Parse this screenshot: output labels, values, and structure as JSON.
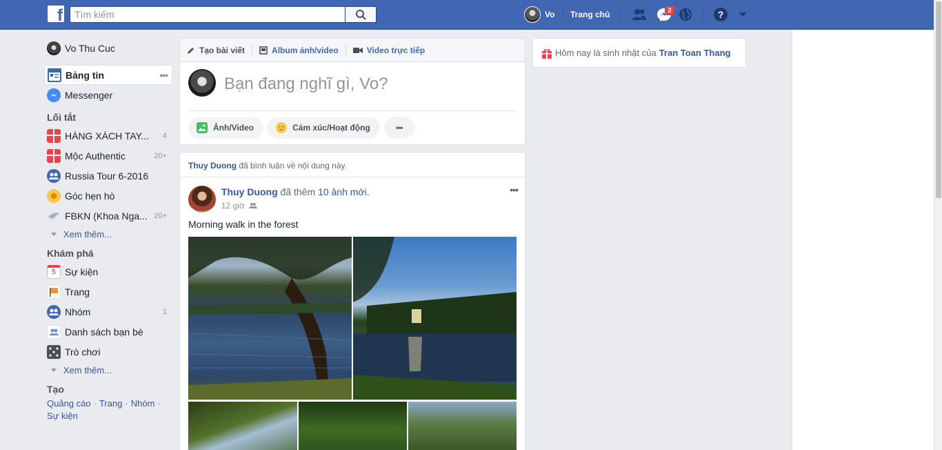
{
  "topbar": {
    "search_placeholder": "Tìm kiếm",
    "user_name": "Vo",
    "home_label": "Trang chủ",
    "messages_badge": "2",
    "icons": [
      "friend-requests-icon",
      "messenger-icon",
      "notifications-globe-icon",
      "help-icon",
      "account-menu-icon"
    ]
  },
  "leftnav": {
    "profile": {
      "name": "Vo Thu Cuc"
    },
    "main": [
      {
        "label": "Bảng tin",
        "icon": "news-feed-icon",
        "active": true
      },
      {
        "label": "Messenger",
        "icon": "messenger-icon"
      }
    ],
    "shortcuts_title": "Lối tắt",
    "shortcuts": [
      {
        "label": "HÀNG XÁCH TAY...",
        "count": "4",
        "icon": "gift-icon"
      },
      {
        "label": "Mộc Authentic",
        "count": "20+",
        "icon": "gift-icon"
      },
      {
        "label": "Russia Tour 6-2016",
        "count": "",
        "icon": "group-icon"
      },
      {
        "label": "Góc hẹn hò",
        "count": "",
        "icon": "flower-icon"
      },
      {
        "label": "FBKN (Khoa Nga...",
        "count": "20+",
        "icon": "bird-icon"
      }
    ],
    "see_more": "Xem thêm...",
    "explore_title": "Khám phá",
    "explore": [
      {
        "label": "Sự kiện",
        "count": "",
        "icon": "calendar-icon",
        "icon_text": "5"
      },
      {
        "label": "Trang",
        "count": "",
        "icon": "flag-icon"
      },
      {
        "label": "Nhóm",
        "count": "1",
        "icon": "group-icon"
      },
      {
        "label": "Danh sách bạn bè",
        "count": "",
        "icon": "friends-list-icon"
      },
      {
        "label": "Trò chơi",
        "count": "",
        "icon": "dice-icon"
      }
    ],
    "create_title": "Tạo",
    "create_links": [
      "Quảng cáo",
      "Trang",
      "Nhóm",
      "Sự kiện"
    ]
  },
  "composer": {
    "tabs": [
      "Tạo bài viết",
      "Album ảnh/video",
      "Video trực tiếp"
    ],
    "prompt": "Bạn đang nghĩ gì, Vo?",
    "actions": [
      "Ảnh/Video",
      "Cảm xúc/Hoạt động"
    ]
  },
  "post": {
    "note_name": "Thuy Duong",
    "note_text": "đã bình luận về nội dung này.",
    "author": "Thuy Duong",
    "action": "đã thêm",
    "action_link": "10 ảnh mới",
    "time": "12 giờ",
    "text": "Morning walk in the forest"
  },
  "birthday": {
    "text": "Hôm nay là sinh nhật của",
    "name": "Tran Toan Thang"
  },
  "colors": {
    "brand": "#4267b2",
    "link": "#365899",
    "badge": "#fa3e3e"
  }
}
